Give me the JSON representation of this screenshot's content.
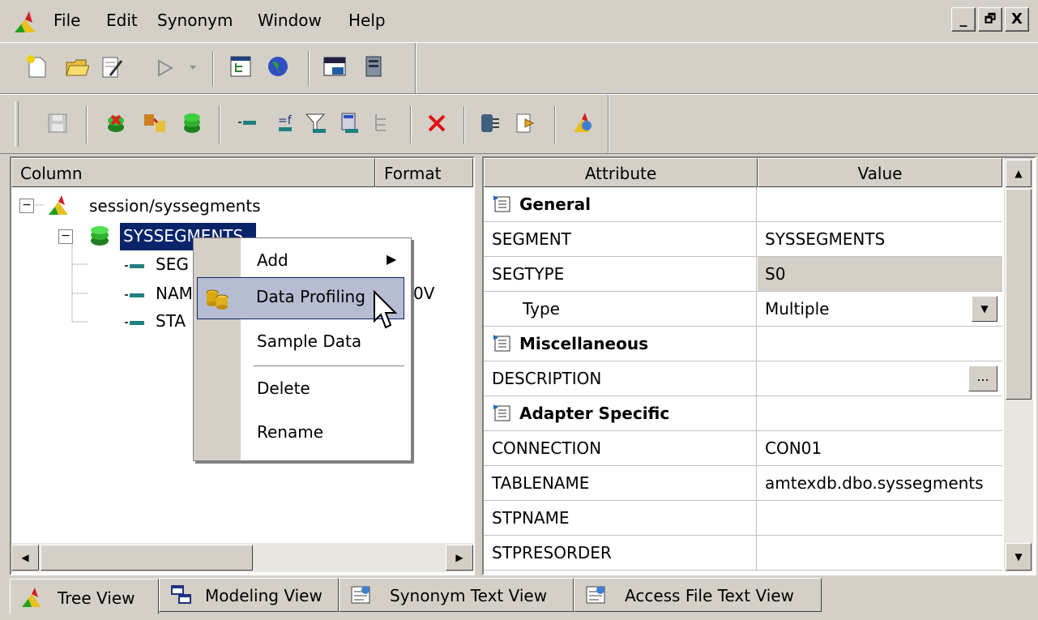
{
  "menubar": {
    "items": [
      "File",
      "Edit",
      "Synonym",
      "Window",
      "Help"
    ],
    "window_controls": [
      "_",
      "🗗",
      "X"
    ]
  },
  "left_pane": {
    "headers": {
      "column": "Column",
      "format": "Format"
    },
    "tree": {
      "root": "session/syssegments",
      "segment": "SYSSEGMENTS",
      "fields": [
        "SEG",
        "NAM",
        "STA"
      ],
      "format_partial": "0V"
    }
  },
  "context_menu": {
    "items": [
      "Add",
      "Data Profiling",
      "Sample Data",
      "Delete",
      "Rename"
    ]
  },
  "right_pane": {
    "headers": {
      "attribute": "Attribute",
      "value": "Value"
    },
    "rows": [
      {
        "attr": "General",
        "value": "",
        "category": true
      },
      {
        "attr": "SEGMENT",
        "value": "SYSSEGMENTS"
      },
      {
        "attr": "SEGTYPE",
        "value": "S0"
      },
      {
        "attr": "Type",
        "value": "Multiple"
      },
      {
        "attr": "Miscellaneous",
        "value": "",
        "category": true
      },
      {
        "attr": "DESCRIPTION",
        "value": ""
      },
      {
        "attr": "Adapter Specific",
        "value": "",
        "category": true
      },
      {
        "attr": "CONNECTION",
        "value": "CON01"
      },
      {
        "attr": "TABLENAME",
        "value": "amtexdb.dbo.syssegments"
      },
      {
        "attr": "STPNAME",
        "value": ""
      },
      {
        "attr": "STPRESORDER",
        "value": ""
      }
    ],
    "description_button": "..."
  },
  "tabs": [
    "Tree View",
    "Modeling View",
    "Synonym Text View",
    "Access File Text View"
  ],
  "colors": {
    "selection": "#0a246a",
    "menu_highlight": "#b6bdd2",
    "highlight_border": "#0a246a",
    "segtype_bg": "#d4d0c8"
  }
}
